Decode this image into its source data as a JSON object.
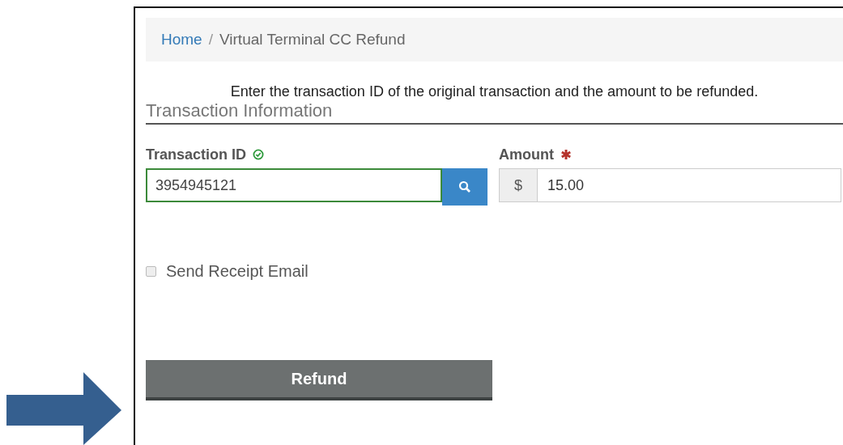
{
  "breadcrumb_separator": "/",
  "breadcrumb": [
    {
      "label": "Home",
      "kind": "link"
    },
    {
      "label": "Virtual Terminal CC Refund",
      "kind": "current"
    }
  ],
  "instructions": "Enter the transaction ID of the original transaction and the amount to be refunded.",
  "section_title": "Transaction Information",
  "transaction_id": {
    "label": "Transaction ID",
    "valid": true,
    "value": "3954945121"
  },
  "amount": {
    "label": "Amount",
    "required": true,
    "prefix": "$",
    "value": "15.00"
  },
  "send_receipt": {
    "label": "Send Receipt Email",
    "checked": false
  },
  "submit_button": "Refund"
}
